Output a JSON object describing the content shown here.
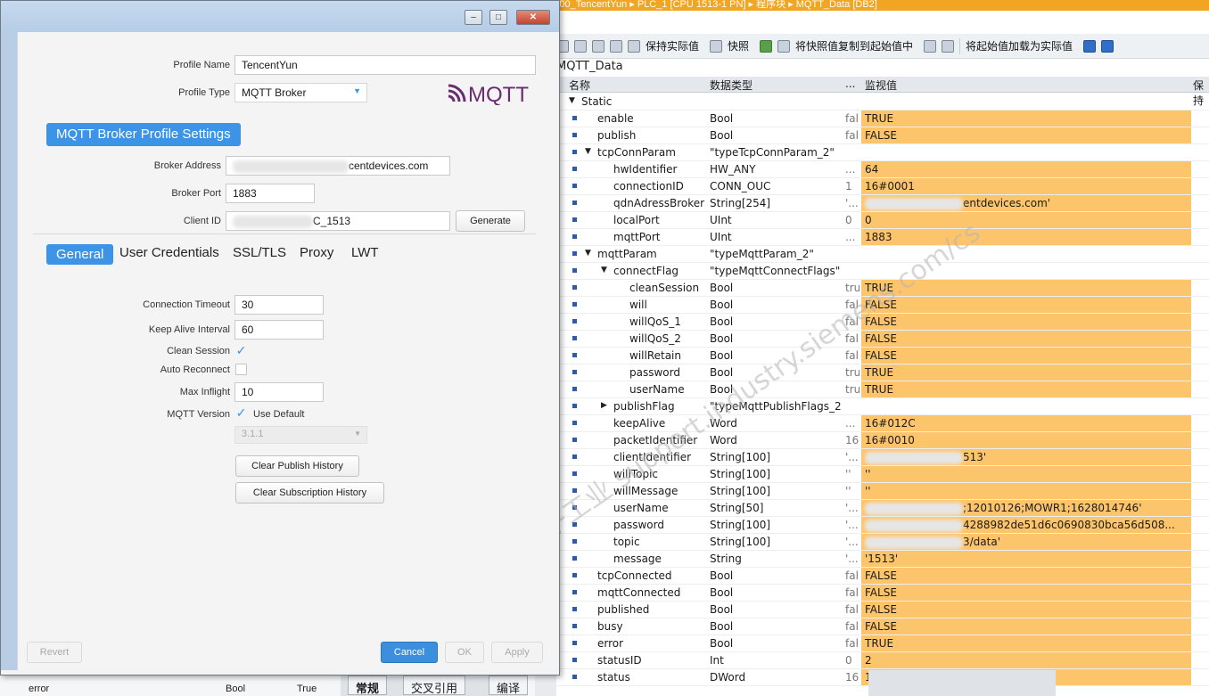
{
  "tia": {
    "breadcrumb": "S7-1500_TencentYun ▸ PLC_1 [CPU 1513-1 PN] ▸ 程序块 ▸ MQTT_Data [DB2]",
    "toolbar": {
      "keep_actual": "保持实际值",
      "snapshot": "快照",
      "copy_snapshot": "将快照值复制到起始值中",
      "load_start": "将起始值加载为实际值"
    },
    "db_title": "MQTT_Data",
    "columns": {
      "name": "名称",
      "type": "数据类型",
      "start": "...",
      "monitor": "监视值",
      "retain": "保持"
    },
    "rows": [
      {
        "indent": 0,
        "tw": "▼",
        "name": "Static",
        "type": "",
        "start": "",
        "mon": ""
      },
      {
        "indent": 1,
        "tw": "",
        "name": "enable",
        "type": "Bool",
        "start": "fal",
        "mon": "TRUE"
      },
      {
        "indent": 1,
        "tw": "",
        "name": "publish",
        "type": "Bool",
        "start": "fal",
        "mon": "FALSE"
      },
      {
        "indent": 1,
        "tw": "▼",
        "name": "tcpConnParam",
        "type": "\"typeTcpConnParam_2\"",
        "start": "",
        "mon": ""
      },
      {
        "indent": 2,
        "tw": "",
        "name": "hwIdentifier",
        "type": "HW_ANY",
        "start": "...",
        "mon": "64"
      },
      {
        "indent": 2,
        "tw": "",
        "name": "connectionID",
        "type": "CONN_OUC",
        "start": "1",
        "mon": "16#0001"
      },
      {
        "indent": 2,
        "tw": "",
        "name": "qdnAdressBroker",
        "type": "String[254]",
        "start": "'...",
        "mon": "entdevices.com'",
        "blur": true
      },
      {
        "indent": 2,
        "tw": "",
        "name": "localPort",
        "type": "UInt",
        "start": "0",
        "mon": "0"
      },
      {
        "indent": 2,
        "tw": "",
        "name": "mqttPort",
        "type": "UInt",
        "start": "...",
        "mon": "1883"
      },
      {
        "indent": 1,
        "tw": "▼",
        "name": "mqttParam",
        "type": "\"typeMqttParam_2\"",
        "start": "",
        "mon": ""
      },
      {
        "indent": 2,
        "tw": "▼",
        "name": "connectFlag",
        "type": "\"typeMqttConnectFlags\"",
        "start": "",
        "mon": ""
      },
      {
        "indent": 3,
        "tw": "",
        "name": "cleanSession",
        "type": "Bool",
        "start": "tru",
        "mon": "TRUE"
      },
      {
        "indent": 3,
        "tw": "",
        "name": "will",
        "type": "Bool",
        "start": "fal",
        "mon": "FALSE"
      },
      {
        "indent": 3,
        "tw": "",
        "name": "willQoS_1",
        "type": "Bool",
        "start": "fal",
        "mon": "FALSE"
      },
      {
        "indent": 3,
        "tw": "",
        "name": "willQoS_2",
        "type": "Bool",
        "start": "fal",
        "mon": "FALSE"
      },
      {
        "indent": 3,
        "tw": "",
        "name": "willRetain",
        "type": "Bool",
        "start": "fal",
        "mon": "FALSE"
      },
      {
        "indent": 3,
        "tw": "",
        "name": "password",
        "type": "Bool",
        "start": "tru",
        "mon": "TRUE"
      },
      {
        "indent": 3,
        "tw": "",
        "name": "userName",
        "type": "Bool",
        "start": "tru",
        "mon": "TRUE"
      },
      {
        "indent": 2,
        "tw": "▶",
        "name": "publishFlag",
        "type": "\"typeMqttPublishFlags_2\"",
        "start": "",
        "mon": ""
      },
      {
        "indent": 2,
        "tw": "",
        "name": "keepAlive",
        "type": "Word",
        "start": "...",
        "mon": "16#012C"
      },
      {
        "indent": 2,
        "tw": "",
        "name": "packetIdentifier",
        "type": "Word",
        "start": "16",
        "mon": "16#0010"
      },
      {
        "indent": 2,
        "tw": "",
        "name": "clientIdentifier",
        "type": "String[100]",
        "start": "'...",
        "mon": "513'",
        "blur": true
      },
      {
        "indent": 2,
        "tw": "",
        "name": "willTopic",
        "type": "String[100]",
        "start": "''",
        "mon": "''"
      },
      {
        "indent": 2,
        "tw": "",
        "name": "willMessage",
        "type": "String[100]",
        "start": "''",
        "mon": "''"
      },
      {
        "indent": 2,
        "tw": "",
        "name": "userName",
        "type": "String[50]",
        "start": "'...",
        "mon": ";12010126;MOWR1;1628014746'",
        "blur": true
      },
      {
        "indent": 2,
        "tw": "",
        "name": "password",
        "type": "String[100]",
        "start": "'...",
        "mon": "4288982de51d6c0690830bca56d508...",
        "blur": true
      },
      {
        "indent": 2,
        "tw": "",
        "name": "topic",
        "type": "String[100]",
        "start": "'...",
        "mon": "3/data'",
        "blur": true
      },
      {
        "indent": 2,
        "tw": "",
        "name": "message",
        "type": "String",
        "start": "'...",
        "mon": "'1513'"
      },
      {
        "indent": 1,
        "tw": "",
        "name": "tcpConnected",
        "type": "Bool",
        "start": "fal",
        "mon": "FALSE"
      },
      {
        "indent": 1,
        "tw": "",
        "name": "mqttConnected",
        "type": "Bool",
        "start": "fal",
        "mon": "FALSE"
      },
      {
        "indent": 1,
        "tw": "",
        "name": "published",
        "type": "Bool",
        "start": "fal",
        "mon": "FALSE"
      },
      {
        "indent": 1,
        "tw": "",
        "name": "busy",
        "type": "Bool",
        "start": "fal",
        "mon": "FALSE"
      },
      {
        "indent": 1,
        "tw": "",
        "name": "error",
        "type": "Bool",
        "start": "fal",
        "mon": "TRUE"
      },
      {
        "indent": 1,
        "tw": "",
        "name": "statusID",
        "type": "Int",
        "start": "0",
        "mon": "2"
      },
      {
        "indent": 1,
        "tw": "",
        "name": "status",
        "type": "DWord",
        "start": "16",
        "mon": "16#0000_80D1"
      }
    ],
    "bottom_tabs": [
      "常规",
      "交叉引用",
      "编译"
    ],
    "behind": {
      "name": "error",
      "type": "Bool",
      "value": "True"
    },
    "watermark": "西门子工业 support.industry.siemens.com/cs"
  },
  "dialog": {
    "profile_name_label": "Profile Name",
    "profile_name": "TencentYun",
    "profile_type_label": "Profile Type",
    "profile_type": "MQTT Broker",
    "logo_text": "MQTT",
    "section_title": "MQTT Broker Profile Settings",
    "broker_address_label": "Broker Address",
    "broker_address": "centdevices.com",
    "broker_port_label": "Broker Port",
    "broker_port": "1883",
    "client_id_label": "Client ID",
    "client_id": "C_1513",
    "generate": "Generate",
    "tabs": [
      "General",
      "User Credentials",
      "SSL/TLS",
      "Proxy",
      "LWT"
    ],
    "connection_timeout_label": "Connection Timeout",
    "connection_timeout": "30",
    "keep_alive_label": "Keep Alive Interval",
    "keep_alive": "60",
    "clean_session_label": "Clean Session",
    "auto_reconnect_label": "Auto Reconnect",
    "max_inflight_label": "Max Inflight",
    "max_inflight": "10",
    "mqtt_version_label": "MQTT Version",
    "use_default": "Use Default",
    "version": "3.1.1",
    "clear_publish": "Clear Publish History",
    "clear_subscription": "Clear Subscription History",
    "revert": "Revert",
    "cancel": "Cancel",
    "ok": "OK",
    "apply": "Apply",
    "clean_session": true,
    "auto_reconnect": false,
    "use_default_checked": true
  },
  "colors": {
    "accent": "#3d94e6",
    "monitor": "#fdc56b",
    "tia_orange": "#f2a523"
  }
}
